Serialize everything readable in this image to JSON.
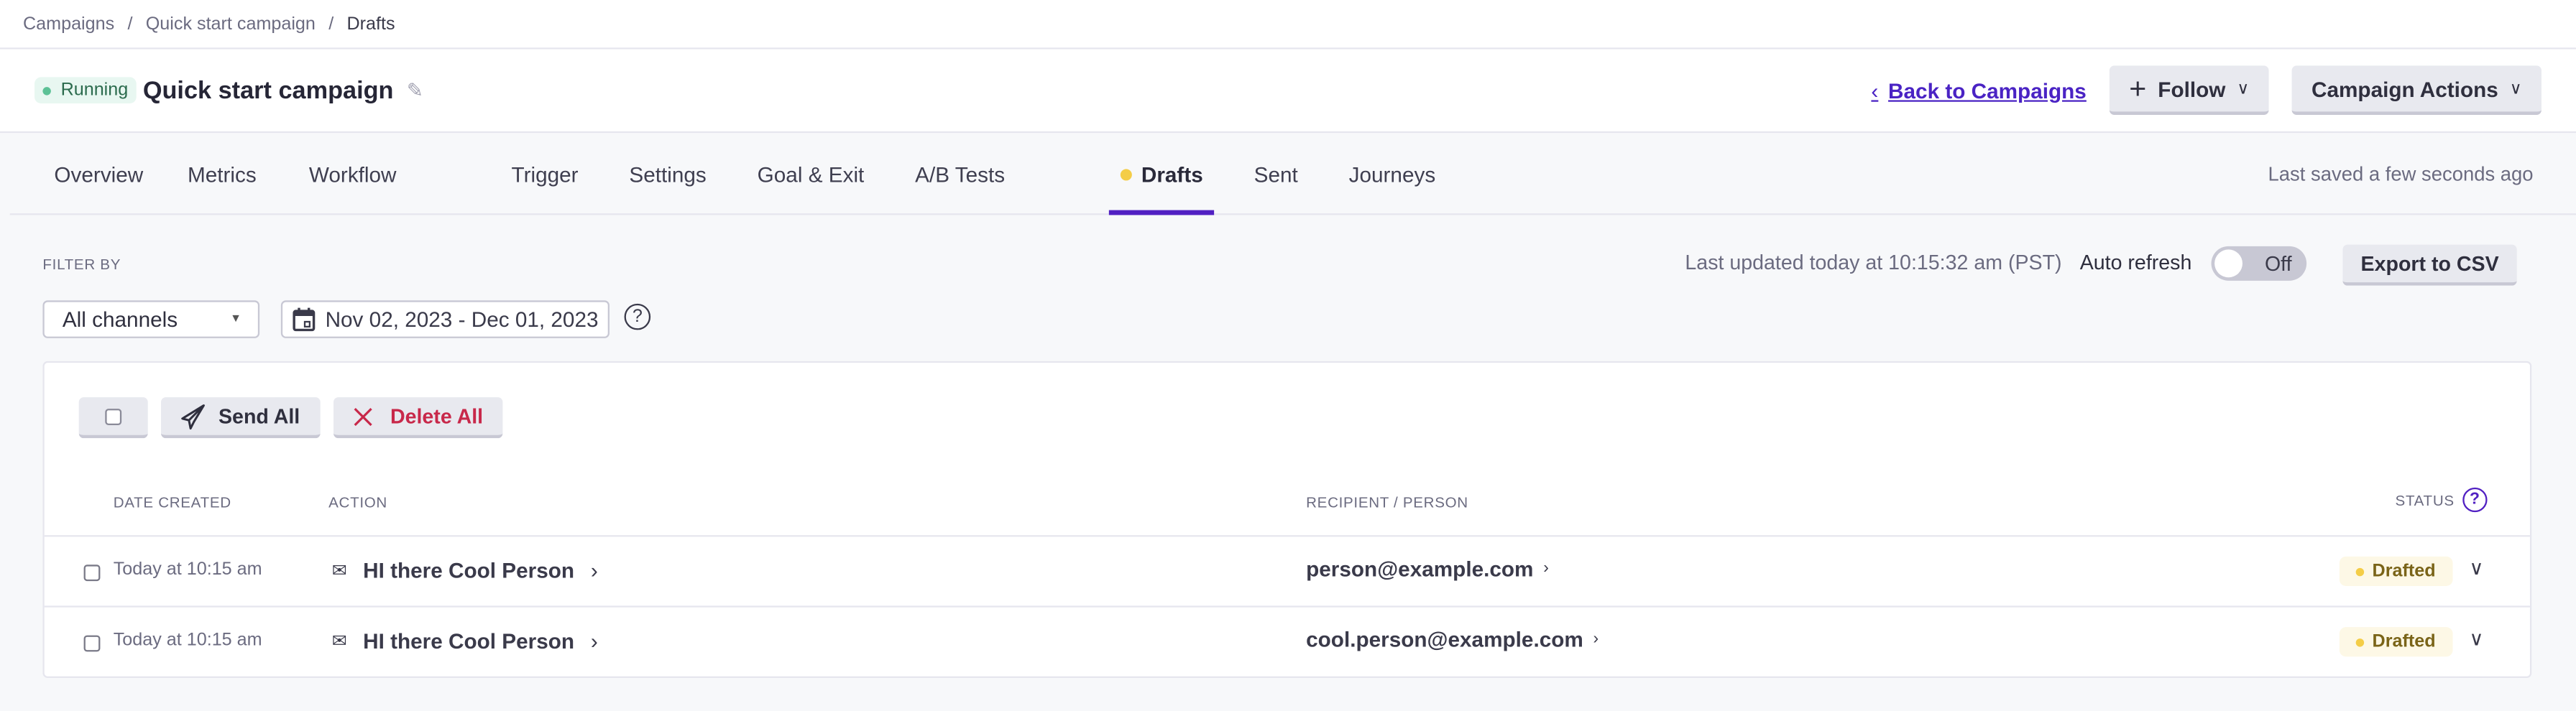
{
  "breadcrumb": [
    "Campaigns",
    "Quick start campaign",
    "Drafts"
  ],
  "header": {
    "status_badge": "Running",
    "title": "Quick start campaign",
    "back_link": "Back to Campaigns",
    "follow_label": "Follow",
    "campaign_actions_label": "Campaign Actions"
  },
  "tabs": [
    {
      "label": "Overview"
    },
    {
      "label": "Metrics"
    },
    {
      "label": "Workflow"
    },
    {
      "label": "Trigger"
    },
    {
      "label": "Settings"
    },
    {
      "label": "Goal & Exit"
    },
    {
      "label": "A/B Tests"
    },
    {
      "label": "Drafts",
      "active": true
    },
    {
      "label": "Sent"
    },
    {
      "label": "Journeys"
    }
  ],
  "last_saved": "Last saved a few seconds ago",
  "filters": {
    "label": "FILTER BY",
    "channel_select": "All channels",
    "date_range": "Nov 02, 2023 - Dec 01, 2023"
  },
  "refresh": {
    "last_updated": "Last updated today at 10:15:32 am (PST)",
    "auto_refresh_label": "Auto refresh",
    "toggle_state": "Off",
    "export_label": "Export to CSV"
  },
  "toolbar": {
    "send_all": "Send All",
    "delete_all": "Delete All"
  },
  "table": {
    "columns": {
      "date_created": "DATE CREATED",
      "action": "ACTION",
      "recipient": "RECIPIENT / PERSON",
      "status": "STATUS"
    },
    "rows": [
      {
        "date": "Today at 10:15 am",
        "action": "HI there Cool Person",
        "recipient": "person@example.com",
        "status": "Drafted"
      },
      {
        "date": "Today at 10:15 am",
        "action": "HI there Cool Person",
        "recipient": "cool.person@example.com",
        "status": "Drafted"
      }
    ]
  },
  "colors": {
    "accent": "#5120c2",
    "running": "#5cc196",
    "drafted": "#f4cd47",
    "danger": "#c8284a"
  }
}
